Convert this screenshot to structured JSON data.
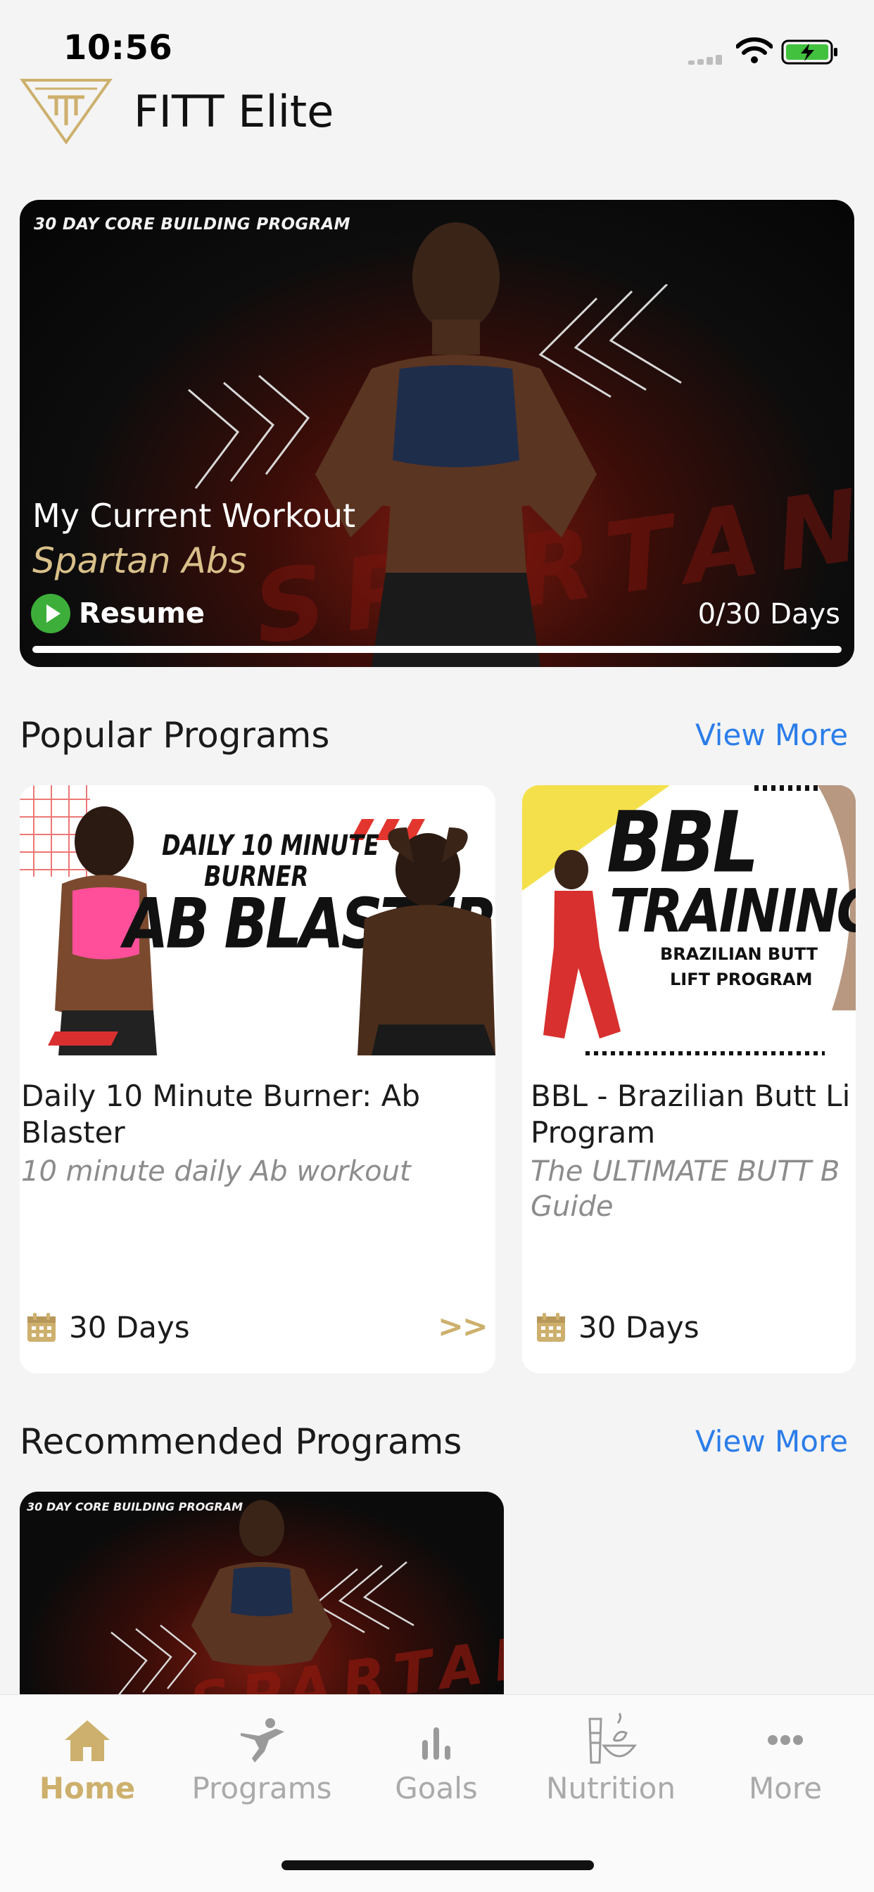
{
  "status_bar": {
    "time": "10:56"
  },
  "header": {
    "brand": "FITT Elite"
  },
  "current_workout": {
    "tag": "30 DAY CORE BUILDING PROGRAM",
    "label": "My Current Workout",
    "title": "Spartan Abs",
    "background_word": "SPARTAN",
    "resume_label": "Resume",
    "days_progress": "0/30 Days",
    "progress_fraction": 0
  },
  "popular": {
    "title": "Popular Programs",
    "view_more": "View More",
    "cards": [
      {
        "image_text": {
          "line1": "DAILY 10 MINUTE",
          "line2": "BURNER",
          "line3": "AB BLASTER"
        },
        "title": "Daily 10 Minute Burner: Ab Blaster",
        "subtitle": "10 minute daily Ab workout",
        "days": "30 Days",
        "arrows": ">>"
      },
      {
        "image_text": {
          "line1": "BBL",
          "line2": "TRAINING",
          "line3": "BRAZILIAN BUTT",
          "line4": "LIFT PROGRAM"
        },
        "title": "BBL - Brazilian Butt Lift Program",
        "subtitle": "The ULTIMATE BUTT Building Guide",
        "days": "30 Days"
      }
    ]
  },
  "recommended": {
    "title": "Recommended Programs",
    "view_more": "View More",
    "cards": [
      {
        "image_tag": "30 DAY CORE BUILDING PROGRAM",
        "background_word": "SPARTAN"
      }
    ]
  },
  "tabbar": {
    "items": [
      {
        "label": "Home",
        "icon": "home-icon",
        "active": true
      },
      {
        "label": "Programs",
        "icon": "programs-icon",
        "active": false
      },
      {
        "label": "Goals",
        "icon": "goals-icon",
        "active": false
      },
      {
        "label": "Nutrition",
        "icon": "nutrition-icon",
        "active": false
      },
      {
        "label": "More",
        "icon": "more-icon",
        "active": false
      }
    ]
  },
  "colors": {
    "accent_gold": "#cdb06d",
    "link_blue": "#2b7de9",
    "resume_green": "#3dae3a",
    "inactive_gray": "#aaaaaa"
  }
}
